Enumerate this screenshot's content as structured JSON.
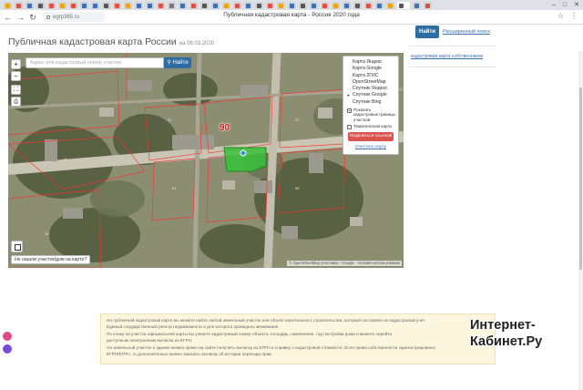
{
  "browser": {
    "address": "egrp365.ru",
    "window_title": "Публичная кадастровая карта - Россия 2020 года",
    "tab_colors": [
      "#f4a300",
      "#e74c3c",
      "#3b6fb6",
      "#555",
      "#e74c3c",
      "#f4a300",
      "#e74c3c",
      "#3b6fb6",
      "#3b6fb6",
      "#555",
      "#e74c3c",
      "#f4a300",
      "#3b6fb6",
      "#3b6fb6",
      "#e74c3c",
      "#777",
      "#3b6fb6",
      "#e74c3c",
      "#555",
      "#3b6fb6",
      "#f4a300",
      "#e74c3c",
      "#3b6fb6",
      "#555",
      "#e74c3c",
      "#f4a300",
      "#3b6fb6",
      "#555",
      "#3b6fb6",
      "#e74c3c",
      "#f4a300",
      "#3b6fb6",
      "#555",
      "#e74c3c",
      "#3b6fb6",
      "#f4a300",
      "#555",
      "#3b6fb6",
      "#e74c3c"
    ]
  },
  "page": {
    "title": "Публичная кадастровая карта России",
    "date": "на 09.03.2020"
  },
  "right_panel": {
    "find_label": "Найти",
    "advanced_label": "Расширенный поиск",
    "owner_link": "кадастровая карта собственников"
  },
  "map": {
    "search_placeholder": "Адрес или кадастровый номер участка",
    "search_button": "Найти",
    "zoom_in": "+",
    "zoom_out": "−",
    "plot_label": "90",
    "layers": [
      {
        "label": "Карта Яндекс",
        "selected": false
      },
      {
        "label": "Карта Google",
        "selected": false
      },
      {
        "label": "Карта 2ГИС",
        "selected": false
      },
      {
        "label": "OpenStreetMap",
        "selected": false
      },
      {
        "label": "Спутник Яндекс",
        "selected": false
      },
      {
        "label": "Спутник Google",
        "selected": true
      },
      {
        "label": "Спутник Bing",
        "selected": false
      }
    ],
    "show_borders": "Показать кадастровые границы участков",
    "thematic_map": "Тематическая карта",
    "share_button": "Поделиться ссылкой",
    "clear_link": "Очистить карту",
    "not_found": "Не нашли участок/дом на карте?",
    "attribution": "© OpenStreetMap участники · Google · Условия использования"
  },
  "info": {
    "lines": [
      "На публичной кадастровой карте вы можете найти любой земельный участок или объект капитального строительства, который поставлен на кадастровый учет.",
      "Единый государственный реестр недвижимости и для которого проведено межевание.",
      "По клику на участок официальной карты вы узнаете кадастровый номер объекта, площадь, назначение, год постройки дома и можете перейти",
      "доступным электронным выписка из ЕГРН.",
      "На земельный участок и здание можно прямо на сайте получить выписку из ЕГРН и справку о кадастровой стоимости. Если права собственности зарегистрированы",
      "ЕГРП/ЕГРН, то дополнительно можно заказать выписку об истории перехода прав."
    ]
  },
  "watermark": {
    "line1": "Интернет-",
    "line2": "Кабинет.Ру"
  }
}
